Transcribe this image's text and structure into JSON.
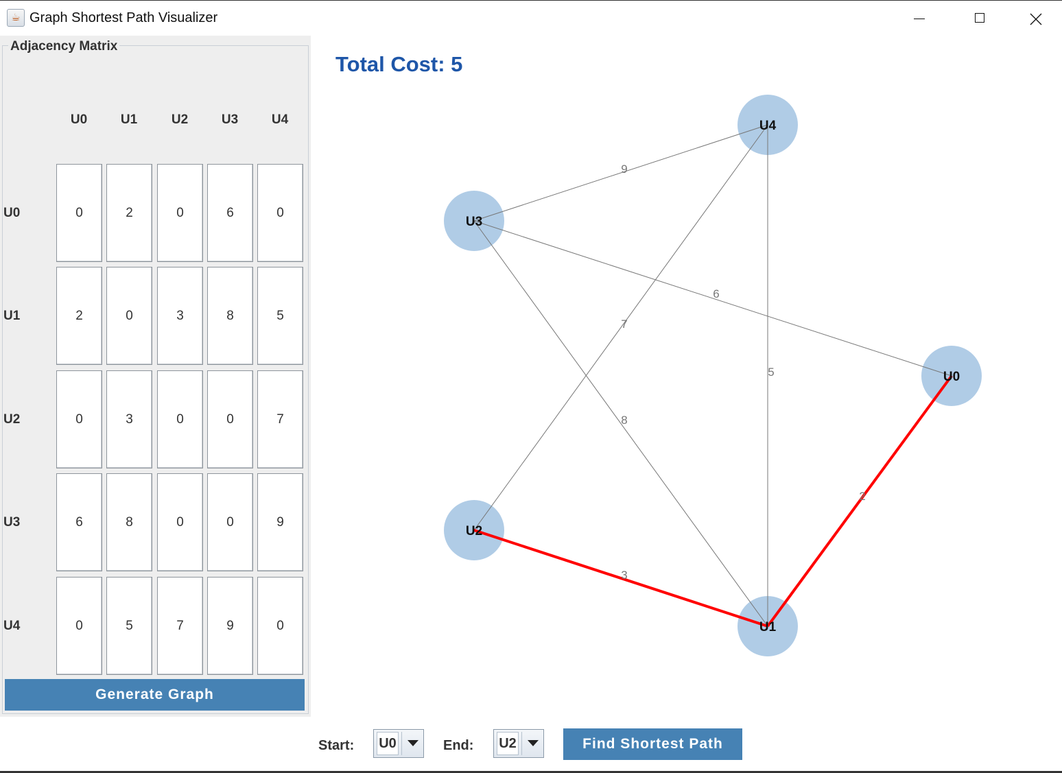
{
  "window": {
    "title": "Graph Shortest Path Visualizer",
    "icon": "java-cup-icon"
  },
  "matrix": {
    "legend": "Adjacency Matrix",
    "columns": [
      "U0",
      "U1",
      "U2",
      "U3",
      "U4"
    ],
    "rows": [
      {
        "label": "U0",
        "values": [
          "0",
          "2",
          "0",
          "6",
          "0"
        ]
      },
      {
        "label": "U1",
        "values": [
          "2",
          "0",
          "3",
          "8",
          "5"
        ]
      },
      {
        "label": "U2",
        "values": [
          "0",
          "3",
          "0",
          "0",
          "7"
        ]
      },
      {
        "label": "U3",
        "values": [
          "6",
          "8",
          "0",
          "0",
          "9"
        ]
      },
      {
        "label": "U4",
        "values": [
          "0",
          "5",
          "7",
          "9",
          "0"
        ]
      }
    ],
    "generate_label": "Generate Graph"
  },
  "graph": {
    "total_cost": "Total Cost: 5",
    "nodes": [
      "U4",
      "U3",
      "U0",
      "U2",
      "U1"
    ],
    "edges": [
      {
        "from": "U3",
        "to": "U4",
        "weight": "9",
        "highlighted": false
      },
      {
        "from": "U3",
        "to": "U0",
        "weight": "6",
        "highlighted": false
      },
      {
        "from": "U2",
        "to": "U4",
        "weight": "7",
        "highlighted": false
      },
      {
        "from": "U4",
        "to": "U1",
        "weight": "5",
        "highlighted": false
      },
      {
        "from": "U3",
        "to": "U1",
        "weight": "8",
        "highlighted": false
      },
      {
        "from": "U0",
        "to": "U1",
        "weight": "2",
        "highlighted": true
      },
      {
        "from": "U2",
        "to": "U1",
        "weight": "3",
        "highlighted": true
      }
    ],
    "colors": {
      "node": "#b0cce6",
      "edge": "#777777",
      "path": "#ff0000",
      "cost_text": "#1e56a8"
    }
  },
  "controls": {
    "start_label": "Start:",
    "start_value": "U0",
    "end_label": "End:",
    "end_value": "U2",
    "find_label": "Find Shortest Path"
  },
  "colors": {
    "button": "#4682b4",
    "panel": "#eeeeee"
  }
}
